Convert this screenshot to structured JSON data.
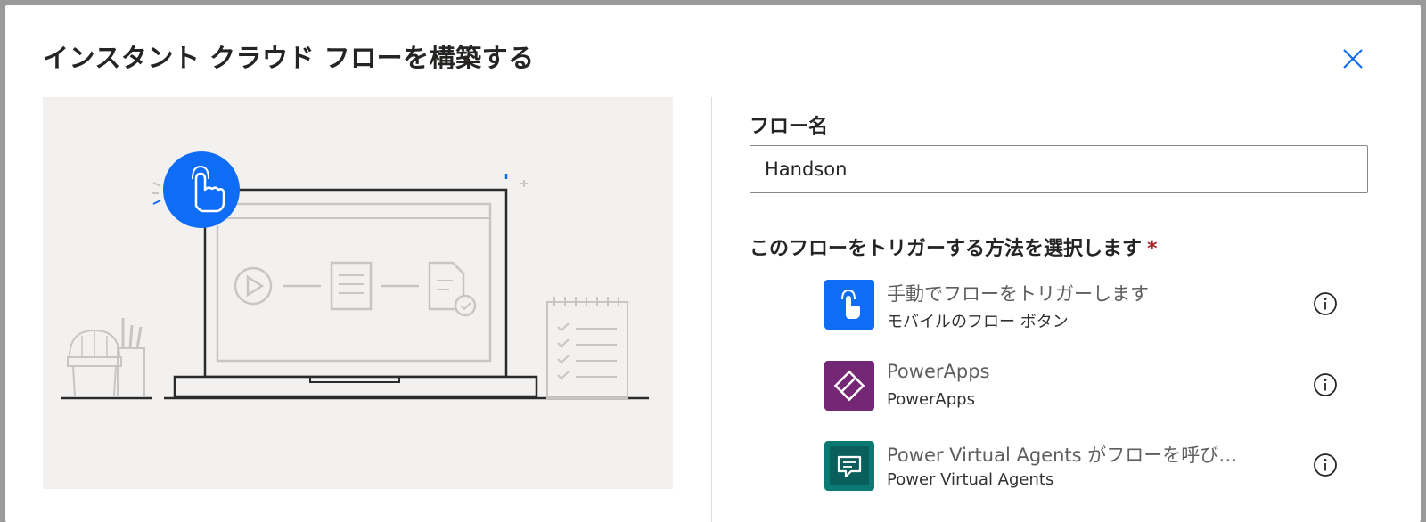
{
  "dialog": {
    "title": "インスタント クラウド フローを構築する"
  },
  "form": {
    "flow_name_label": "フロー名",
    "flow_name_value": "Handson",
    "trigger_label": "このフローをトリガーする方法を選択します",
    "required_marker": "*"
  },
  "triggers": [
    {
      "title": "手動でフローをトリガーします",
      "subtitle": "モバイルのフロー ボタン",
      "icon": "touch-hand-icon",
      "color": "#0f6cf5"
    },
    {
      "title": "PowerApps",
      "subtitle": "PowerApps",
      "icon": "powerapps-icon",
      "color": "#742774"
    },
    {
      "title": "Power Virtual Agents がフローを呼び…",
      "subtitle": "Power Virtual Agents",
      "icon": "chat-bubble-icon",
      "color": "#0b7a75"
    }
  ],
  "colors": {
    "accent": "#0f6cf5",
    "close": "#0f6cf5"
  }
}
